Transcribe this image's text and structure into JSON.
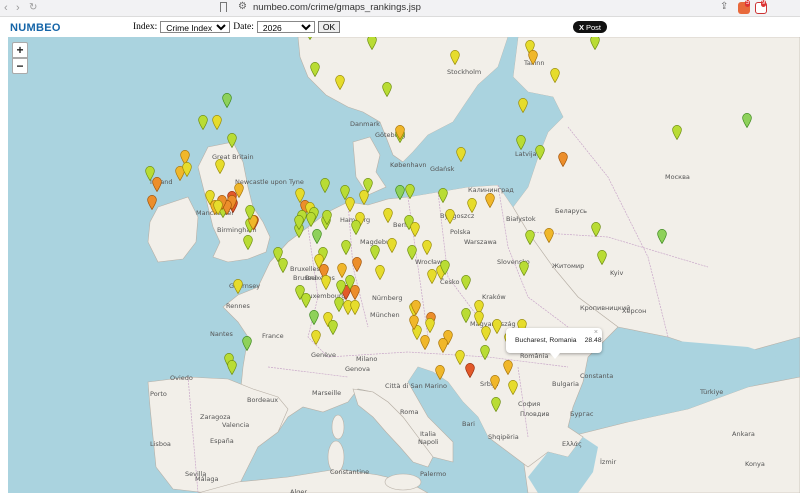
{
  "browser": {
    "url": "numbeo.com/crime/gmaps_rankings.jsp",
    "ext_badge_1": "5",
    "ext_badge_2": "9"
  },
  "header": {
    "logo": "NUMBEO",
    "index_label": "Index:",
    "index_value": "Crime Index",
    "date_label": "Date:",
    "date_value": "2026",
    "ok_label": "OK",
    "post_label": "Post"
  },
  "map": {
    "zoom_in": "+",
    "zoom_out": "−",
    "popup": {
      "city": "Bucharest, Romania",
      "value": "28.48",
      "close": "×"
    },
    "labels": [
      {
        "t": "Stockholm"
      },
      {
        "t": "Tallinn"
      },
      {
        "t": "Göteborg"
      },
      {
        "t": "Latvija"
      },
      {
        "t": "Москва"
      },
      {
        "t": "Danmark"
      },
      {
        "t": "København"
      },
      {
        "t": "Калининград"
      },
      {
        "t": "Newcastle upon Tyne"
      },
      {
        "t": "Great Britain"
      },
      {
        "t": "Ireland"
      },
      {
        "t": "Manchester"
      },
      {
        "t": "Birmingham"
      },
      {
        "t": "Hamburg"
      },
      {
        "t": "Gdańsk"
      },
      {
        "t": "Bydgoszcz"
      },
      {
        "t": "Беларусь"
      },
      {
        "t": "Białystok"
      },
      {
        "t": "Berlin"
      },
      {
        "t": "Magdeburg"
      },
      {
        "t": "Warszawa"
      },
      {
        "t": "Polska"
      },
      {
        "t": "Wrocław"
      },
      {
        "t": "Bruxelles"
      },
      {
        "t": "Brussel"
      },
      {
        "t": "Luxembourg"
      },
      {
        "t": "Nürnberg"
      },
      {
        "t": "Česko"
      },
      {
        "t": "Kraków"
      },
      {
        "t": "Kyiv"
      },
      {
        "t": "Житомир"
      },
      {
        "t": "Guernsey"
      },
      {
        "t": "Rennes"
      },
      {
        "t": "München"
      },
      {
        "t": "Slovensko"
      },
      {
        "t": "Кропивницкий"
      },
      {
        "t": "Херсон"
      },
      {
        "t": "Magyarország"
      },
      {
        "t": "France"
      },
      {
        "t": "Nantes"
      },
      {
        "t": "Genève"
      },
      {
        "t": "Bordeaux"
      },
      {
        "t": "Milano"
      },
      {
        "t": "Genova"
      },
      {
        "t": "Srbija"
      },
      {
        "t": "Constanta"
      },
      {
        "t": "Oviedo"
      },
      {
        "t": "Marseille"
      },
      {
        "t": "Città di San Marino"
      },
      {
        "t": "România"
      },
      {
        "t": "Bulgaria"
      },
      {
        "t": "София"
      },
      {
        "t": "Пловдив"
      },
      {
        "t": "Бургас"
      },
      {
        "t": "Porto"
      },
      {
        "t": "Zaragoza"
      },
      {
        "t": "España"
      },
      {
        "t": "Roma"
      },
      {
        "t": "Italia"
      },
      {
        "t": "Napoli"
      },
      {
        "t": "Bari"
      },
      {
        "t": "Shqipëria"
      },
      {
        "t": "Valencia"
      },
      {
        "t": "Lisboa"
      },
      {
        "t": "Sevilla"
      },
      {
        "t": "Málaga"
      },
      {
        "t": "Alger"
      },
      {
        "t": "Constantine"
      },
      {
        "t": "Palermo"
      },
      {
        "t": "Ελλάς"
      },
      {
        "t": "Türkiye"
      },
      {
        "t": "İzmir"
      },
      {
        "t": "Ankara"
      },
      {
        "t": "Konya"
      },
      {
        "t": "Bruxelles"
      }
    ],
    "markers": [
      {
        "v": 35
      },
      {
        "v": 30
      },
      {
        "v": 45
      },
      {
        "v": 40
      },
      {
        "v": 55
      },
      {
        "v": 30
      },
      {
        "v": 25
      },
      {
        "v": 40
      },
      {
        "v": 35
      },
      {
        "v": 45
      },
      {
        "v": 30
      },
      {
        "v": 45
      },
      {
        "v": 25
      },
      {
        "v": 35
      },
      {
        "v": 40
      },
      {
        "v": 30
      },
      {
        "v": 25
      },
      {
        "v": 35
      },
      {
        "v": 30
      },
      {
        "v": 55
      },
      {
        "v": 30
      },
      {
        "v": 30
      },
      {
        "v": 45
      },
      {
        "v": 60
      },
      {
        "v": 50
      },
      {
        "v": 55
      },
      {
        "v": 45
      },
      {
        "v": 45
      },
      {
        "v": 50
      },
      {
        "v": 65
      },
      {
        "v": 70
      },
      {
        "v": 60
      },
      {
        "v": 30
      },
      {
        "v": 40
      },
      {
        "v": 50
      },
      {
        "v": 60
      },
      {
        "v": 40
      },
      {
        "v": 30
      },
      {
        "v": 35
      },
      {
        "v": 30
      },
      {
        "v": 45
      },
      {
        "v": 45
      },
      {
        "v": 40
      },
      {
        "v": 60
      },
      {
        "v": 40
      },
      {
        "v": 30
      },
      {
        "v": 35
      },
      {
        "v": 35
      },
      {
        "v": 30
      },
      {
        "v": 35
      },
      {
        "v": 30
      },
      {
        "v": 30
      },
      {
        "v": 50
      },
      {
        "v": 45
      },
      {
        "v": 40
      },
      {
        "v": 40
      },
      {
        "v": 25
      },
      {
        "v": 30
      },
      {
        "v": 25
      },
      {
        "v": 30
      },
      {
        "v": 40
      },
      {
        "v": 30
      },
      {
        "v": 35
      },
      {
        "v": 35
      },
      {
        "v": 30
      },
      {
        "v": 35
      },
      {
        "v": 30
      },
      {
        "v": 40
      },
      {
        "v": 35
      },
      {
        "v": 40
      },
      {
        "v": 30
      },
      {
        "v": 30
      },
      {
        "v": 55
      },
      {
        "v": 35
      },
      {
        "v": 30
      },
      {
        "v": 25
      },
      {
        "v": 30
      },
      {
        "v": 60
      },
      {
        "v": 60
      },
      {
        "v": 65
      },
      {
        "v": 55
      },
      {
        "v": 60
      },
      {
        "v": 40
      },
      {
        "v": 30
      },
      {
        "v": 35
      },
      {
        "v": 30
      },
      {
        "v": 35
      },
      {
        "v": 45
      },
      {
        "v": 60
      },
      {
        "v": 55
      },
      {
        "v": 40
      },
      {
        "v": 60
      },
      {
        "v": 65
      },
      {
        "v": 60
      },
      {
        "v": 30
      },
      {
        "v": 40
      },
      {
        "v": 35
      },
      {
        "v": 30
      },
      {
        "v": 45
      },
      {
        "v": 40
      },
      {
        "v": 35
      },
      {
        "v": 40
      },
      {
        "v": 35
      },
      {
        "v": 35
      },
      {
        "v": 40
      },
      {
        "v": 45
      },
      {
        "v": 60
      },
      {
        "v": 55
      },
      {
        "v": 50
      },
      {
        "v": 45
      },
      {
        "v": 45
      },
      {
        "v": 45
      },
      {
        "v": 40
      },
      {
        "v": 45
      },
      {
        "v": 35
      },
      {
        "v": 40
      },
      {
        "v": 55
      },
      {
        "v": 50
      },
      {
        "v": 40
      },
      {
        "v": 35
      },
      {
        "v": 30
      },
      {
        "v": 25
      },
      {
        "v": 30
      },
      {
        "v": 35
      },
      {
        "v": 40
      },
      {
        "v": 25
      },
      {
        "v": 45
      },
      {
        "v": 40
      },
      {
        "v": 30
      },
      {
        "v": 40
      },
      {
        "v": 50
      },
      {
        "v": 45
      },
      {
        "v": 50
      },
      {
        "v": 65
      },
      {
        "v": 55
      },
      {
        "v": 50
      },
      {
        "v": 40
      },
      {
        "v": 30
      }
    ]
  }
}
